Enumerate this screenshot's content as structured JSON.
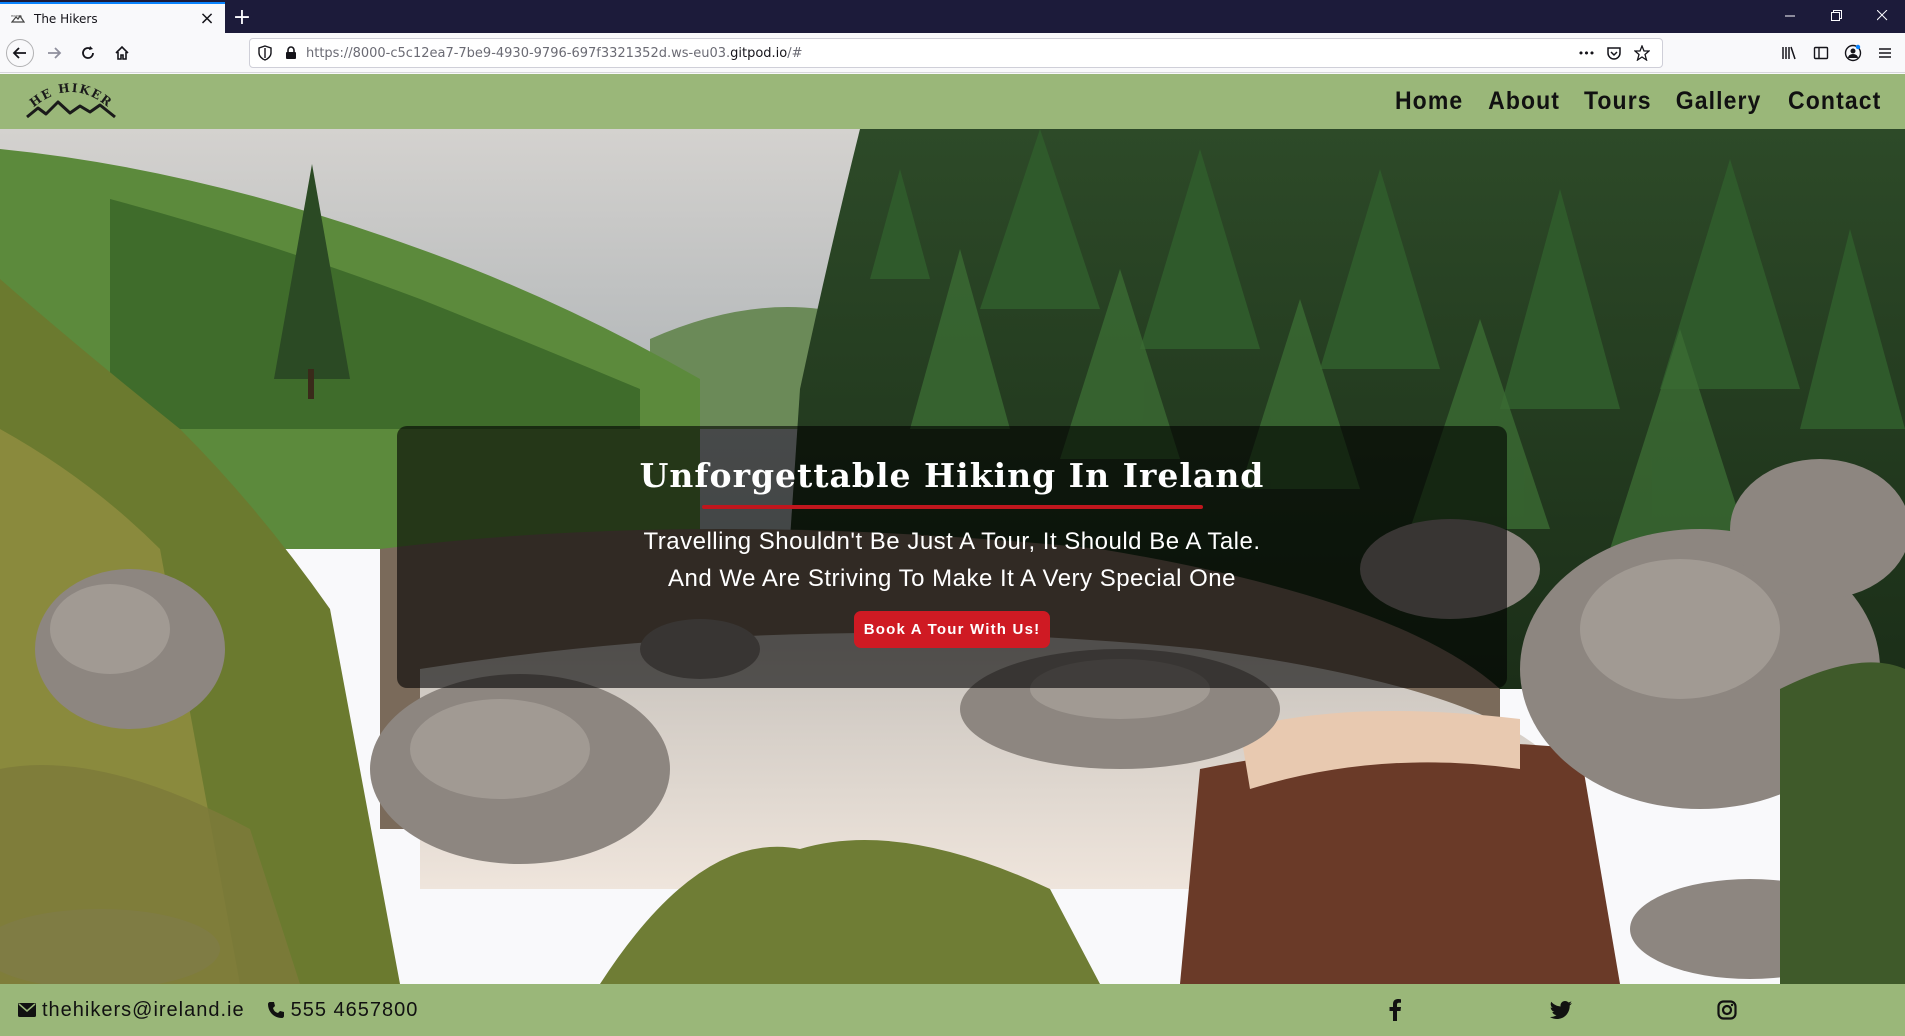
{
  "browser": {
    "tab_title": "The Hikers",
    "new_tab_symbol": "+",
    "url_prefix": "https://8000-c5c12ea7-7be9-4930-9796-697f3321352d.ws-eu03.",
    "url_domain": "gitpod.io",
    "url_suffix": "/#",
    "more_symbol": "•••"
  },
  "site": {
    "logo_text": "THE HIKERS",
    "nav": [
      "Home",
      "About",
      "Tours",
      "Gallery",
      "Contact"
    ],
    "hero": {
      "title": "Unforgettable Hiking In Ireland",
      "line1": "Travelling Shouldn't Be Just A Tour, It Should Be A Tale.",
      "line2": "And We Are Striving To Make It A Very Special One",
      "cta": "Book A Tour With Us!"
    },
    "footer": {
      "email": "thehikers@ireland.ie",
      "phone": "555 4657800",
      "social_icons": [
        "facebook-icon",
        "twitter-icon",
        "instagram-icon"
      ]
    }
  },
  "colors": {
    "header_green": "#9ab779",
    "accent_red": "#cf1a23",
    "rule_red": "#c0161d",
    "browser_dark": "#1c1b3a"
  }
}
